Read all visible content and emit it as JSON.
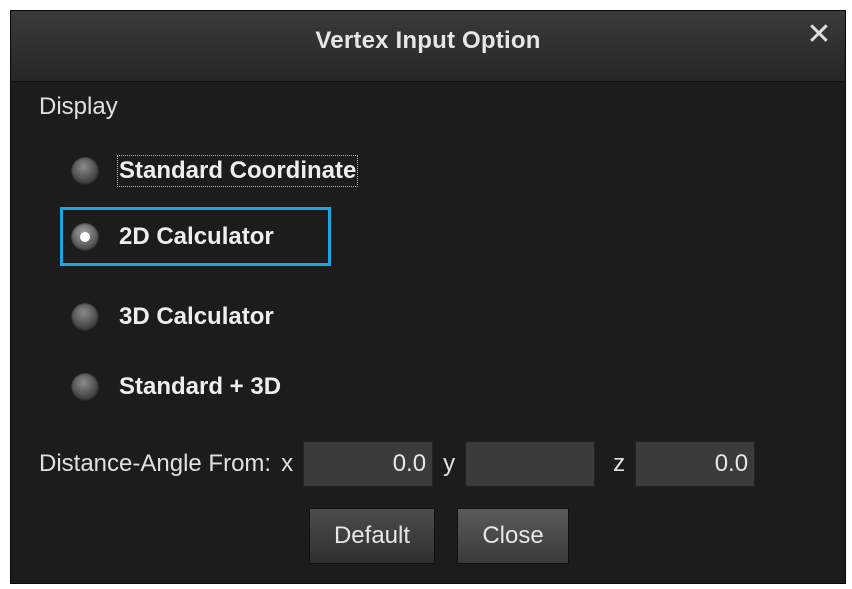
{
  "dialog": {
    "title": "Vertex Input Option",
    "close_icon": "close-icon"
  },
  "display": {
    "label": "Display",
    "options": [
      {
        "label": "Standard Coordinate",
        "checked": false
      },
      {
        "label": "2D Calculator",
        "checked": true
      },
      {
        "label": "3D Calculator",
        "checked": false
      },
      {
        "label": "Standard + 3D",
        "checked": false
      }
    ]
  },
  "distance": {
    "label": "Distance-Angle From:",
    "x_label": "x",
    "x_value": "0.0",
    "y_label": "y",
    "y_value": "",
    "z_label": "z",
    "z_value": "0.0"
  },
  "buttons": {
    "default_label": "Default",
    "close_label": "Close"
  },
  "colors": {
    "highlight": "#1aa6e0",
    "background": "#1c1c1c"
  }
}
